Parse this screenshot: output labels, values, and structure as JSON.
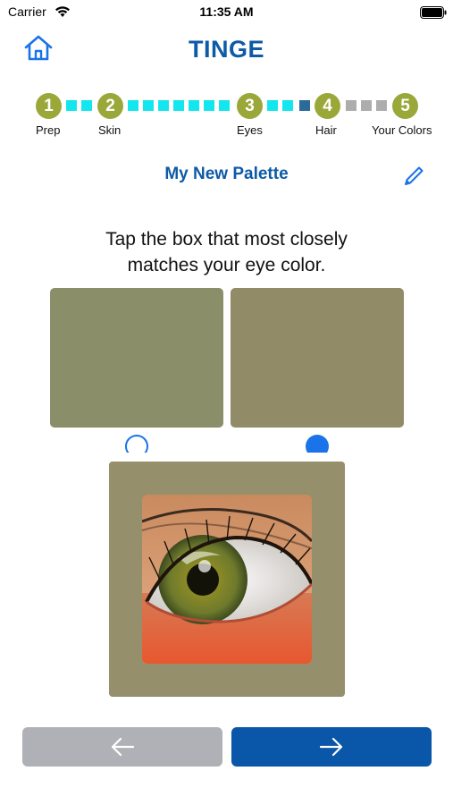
{
  "status_bar": {
    "carrier": "Carrier",
    "time": "11:35 AM"
  },
  "header": {
    "title": "TINGE",
    "home_icon": "home-icon"
  },
  "progress": {
    "steps": [
      {
        "number": "1",
        "label": "Prep"
      },
      {
        "number": "2",
        "label": "Skin"
      },
      {
        "number": "3",
        "label": "Eyes"
      },
      {
        "number": "4",
        "label": "Hair"
      },
      {
        "number": "5",
        "label": "Your Colors"
      }
    ],
    "current_step": 4,
    "colors": {
      "done": "#9aa83a",
      "filled": "#14e6ee",
      "current": "#2c6b99",
      "pending": "#adadad"
    }
  },
  "palette": {
    "name": "My New Palette",
    "edit_icon": "pencil-icon"
  },
  "instruction": {
    "line1": "Tap the box that most closely",
    "line2": "matches your eye color."
  },
  "swatches": [
    {
      "color": "#8a8f69",
      "selected": false
    },
    {
      "color": "#918c67",
      "selected": true
    }
  ],
  "preview": {
    "background": "#958f6c",
    "image": "eye-photo"
  },
  "nav": {
    "back": {
      "icon": "arrow-left-icon",
      "color": "#b0b1b6"
    },
    "next": {
      "icon": "arrow-right-icon",
      "color": "#0a56a8"
    }
  }
}
